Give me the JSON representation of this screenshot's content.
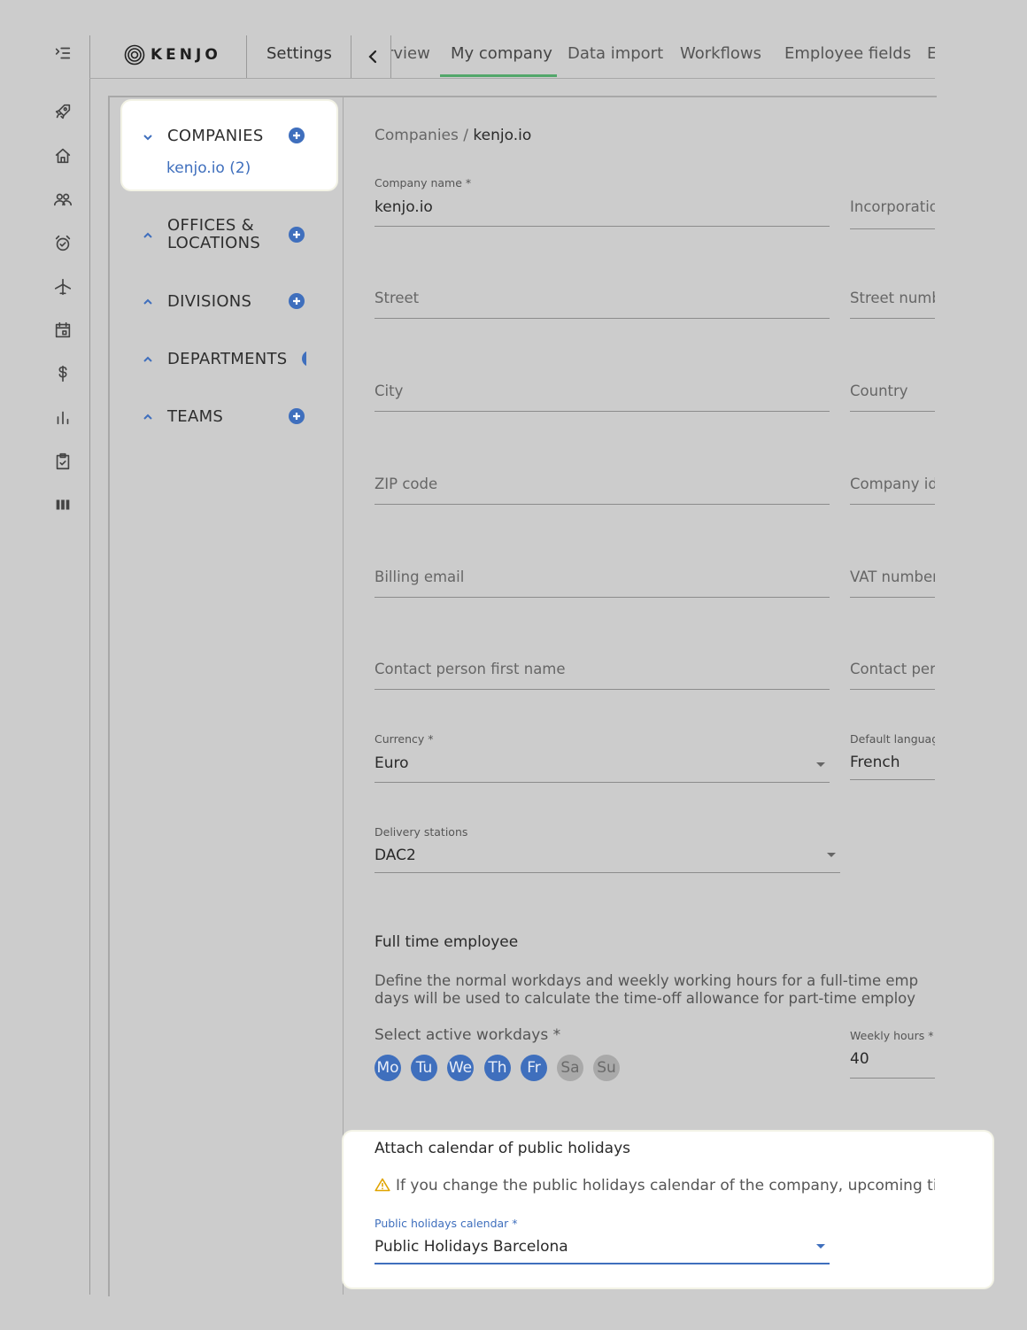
{
  "header": {
    "logo_text": "KENJO",
    "settings_label": "Settings",
    "tabs": [
      {
        "label": "rview"
      },
      {
        "label": "My company",
        "active": true
      },
      {
        "label": "Data import"
      },
      {
        "label": "Workflows"
      },
      {
        "label": "Employee fields"
      },
      {
        "label": "E"
      }
    ]
  },
  "sidebar": {
    "icons": [
      "menu-collapse-icon",
      "rocket-icon",
      "home-icon",
      "people-icon",
      "alarm-clock-icon",
      "airplane-icon",
      "calendar-icon",
      "dollar-icon",
      "bar-chart-icon",
      "clipboard-check-icon",
      "columns-icon"
    ]
  },
  "structure": {
    "companies": {
      "label": "COMPANIES",
      "item": "kenjo.io (2)"
    },
    "offices": {
      "label_line1": "OFFICES &",
      "label_line2": "LOCATIONS"
    },
    "divisions": {
      "label": "DIVISIONS"
    },
    "departments": {
      "label": "DEPARTMENTS"
    },
    "teams": {
      "label": "TEAMS"
    }
  },
  "form": {
    "breadcrumb_root": "Companies / ",
    "breadcrumb_current": "kenjo.io",
    "company_name_label": "Company name *",
    "company_name_value": "kenjo.io",
    "incorporation_label": "Incorporatio",
    "street_label": "Street",
    "street_number_label": "Street numb",
    "city_label": "City",
    "country_label": "Country",
    "zip_label": "ZIP code",
    "company_id_label": "Company id",
    "billing_email_label": "Billing email",
    "vat_label": "VAT number",
    "contact_first_label": "Contact person first name",
    "contact_last_label": "Contact pers",
    "currency_label": "Currency *",
    "currency_value": "Euro",
    "language_label": "Default languag",
    "language_value": "French",
    "delivery_label": "Delivery stations",
    "delivery_value": "DAC2"
  },
  "fulltime": {
    "title": "Full time employee",
    "description_line1": "Define the normal workdays and weekly working hours for a full-time emp",
    "description_line2": "days will be used to calculate the time-off allowance for part-time employ",
    "workdays_label": "Select active workdays *",
    "days": [
      {
        "label": "Mo",
        "active": true
      },
      {
        "label": "Tu",
        "active": true
      },
      {
        "label": "We",
        "active": true
      },
      {
        "label": "Th",
        "active": true
      },
      {
        "label": "Fr",
        "active": true
      },
      {
        "label": "Sa",
        "active": false
      },
      {
        "label": "Su",
        "active": false
      }
    ],
    "weekly_hours_label": "Weekly hours *",
    "weekly_hours_value": "40"
  },
  "holidays": {
    "title": "Attach calendar of public holidays",
    "warning": "If you change the public holidays calendar of the company, upcoming ti",
    "calendar_label": "Public holidays calendar *",
    "calendar_value": "Public Holidays Barcelona"
  },
  "colors": {
    "accent": "#3f6fbd",
    "tab_underline": "#52a76a",
    "highlight": "#ffffff",
    "warning": "#e0a400"
  }
}
